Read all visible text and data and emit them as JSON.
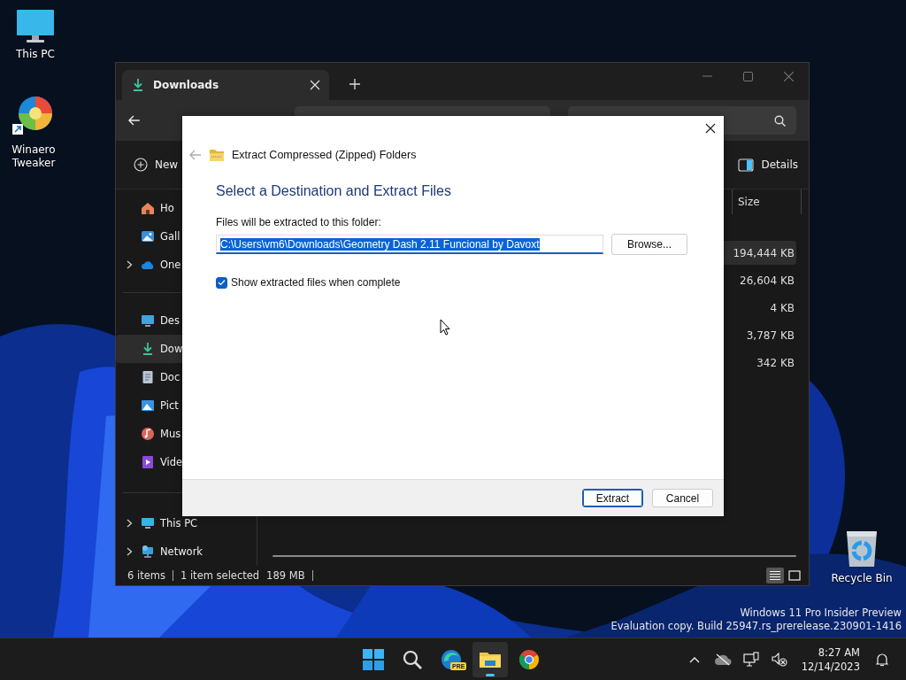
{
  "desktop_icons": [
    {
      "kind": "monitor",
      "label": "This PC"
    },
    {
      "kind": "swirl",
      "label": "Winaero Tweaker",
      "shortcut": true
    },
    {
      "kind": "recycle",
      "label": "Recycle Bin"
    }
  ],
  "explorer": {
    "tabs": [
      {
        "label": "Downloads",
        "selected": true
      }
    ],
    "command_bar": {
      "new_label": "New",
      "details_label": "Details"
    },
    "sidebar": {
      "groups": [
        [
          {
            "kind": "home",
            "label": "Ho",
            "expandable": false,
            "selected": false
          },
          {
            "kind": "gallery",
            "label": "Gall",
            "expandable": false,
            "selected": false
          },
          {
            "kind": "cloud",
            "label": "One",
            "expandable": true,
            "selected": false
          }
        ],
        [
          {
            "kind": "desktop",
            "label": "Des",
            "expandable": false,
            "selected": false
          },
          {
            "kind": "download",
            "label": "Dow",
            "expandable": false,
            "selected": true
          },
          {
            "kind": "document",
            "label": "Doc",
            "expandable": false,
            "selected": false
          },
          {
            "kind": "pictures",
            "label": "Pict",
            "expandable": false,
            "selected": false
          },
          {
            "kind": "music",
            "label": "Mus",
            "expandable": false,
            "selected": false
          },
          {
            "kind": "video",
            "label": "Vide",
            "expandable": false,
            "selected": false
          }
        ],
        [
          {
            "kind": "pc",
            "label": "This PC",
            "expandable": true,
            "selected": false
          },
          {
            "kind": "network",
            "label": "Network",
            "expandable": true,
            "selected": false
          }
        ]
      ]
    },
    "size_column": {
      "header": "Size",
      "rows": [
        {
          "value": "194,444 KB",
          "selected": true
        },
        {
          "value": "26,604 KB",
          "selected": false
        },
        {
          "value": "4 KB",
          "selected": false
        },
        {
          "value": "3,787 KB",
          "selected": false
        },
        {
          "value": "342 KB",
          "selected": false
        }
      ]
    },
    "status_bar": {
      "item_count": "6 items",
      "selection": "1 item selected",
      "selection_size": "189 MB"
    },
    "view_buttons": [
      {
        "kind": "details",
        "selected": true
      },
      {
        "kind": "preview",
        "selected": false
      }
    ]
  },
  "dialog": {
    "title": "Extract Compressed (Zipped) Folders",
    "heading": "Select a Destination and Extract Files",
    "field_label": "Files will be extracted to this folder:",
    "path": "C:\\Users\\vm6\\Downloads\\Geometry Dash 2.11 Funcional by Davoxt",
    "path_selected": true,
    "browse": "Browse...",
    "show_files": {
      "label": "Show extracted files when complete",
      "checked": true
    },
    "buttons": [
      {
        "label": "Extract",
        "default": true
      },
      {
        "label": "Cancel",
        "default": false
      }
    ]
  },
  "edition_notice": [
    "Windows 11 Pro Insider Preview",
    "Evaluation copy. Build 25947.rs_prerelease.230901-1416"
  ],
  "taskbar": {
    "apps": [
      {
        "kind": "start",
        "selected": false
      },
      {
        "kind": "search",
        "selected": false
      },
      {
        "kind": "edge",
        "badge": "PRE",
        "selected": false
      },
      {
        "kind": "explorer",
        "selected": true
      },
      {
        "kind": "chrome",
        "selected": false
      }
    ],
    "clock": {
      "time": "8:27 AM",
      "date": "12/14/2023"
    }
  }
}
